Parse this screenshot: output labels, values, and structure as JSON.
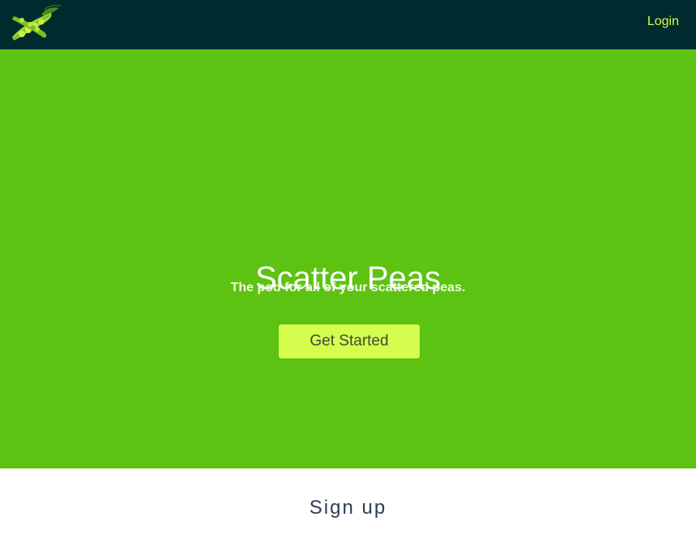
{
  "navbar": {
    "logo_icon": "pea-pod-icon",
    "login_label": "Login"
  },
  "hero": {
    "title": "Scatter Peas",
    "tagline": "The pod for all of your scattered peas.",
    "cta_label": "Get Started"
  },
  "signup": {
    "heading": "Sign up"
  },
  "colors": {
    "navbar_bg": "#002b2e",
    "hero_bg": "#5dc312",
    "accent": "#d6fc4e",
    "login_link": "#d4f94c",
    "signup_heading": "#2e3d54"
  }
}
